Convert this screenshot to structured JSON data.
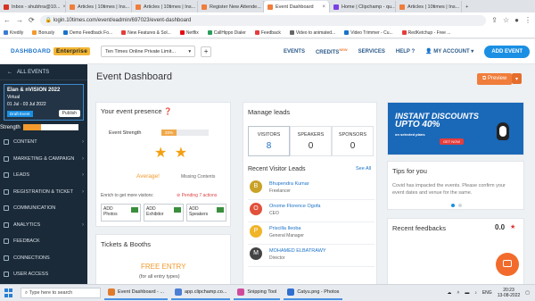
{
  "browser": {
    "tabs": [
      {
        "label": "Inbox - shubhra@10...",
        "color": "#d93025",
        "active": false
      },
      {
        "label": "Articles | 10times | Ins...",
        "color": "#f07d3b",
        "active": false
      },
      {
        "label": "Articles | 10times | Ins...",
        "color": "#f07d3b",
        "active": false
      },
      {
        "label": "Register New Attende...",
        "color": "#f07d3b",
        "active": false
      },
      {
        "label": "Event Dashboard",
        "color": "#f07d3b",
        "active": true
      },
      {
        "label": "Home | Clipchamp - qu...",
        "color": "#7b3fe4",
        "active": false
      },
      {
        "label": "Articles | 10times | Ins...",
        "color": "#f07d3b",
        "active": false
      }
    ],
    "url": "login.10times.com/event/eadmin/697023/event-dashboard",
    "bookmarks": [
      {
        "label": "Kredily",
        "color": "#3a7bd5"
      },
      {
        "label": "Bonusly",
        "color": "#f29a2e"
      },
      {
        "label": "Demo Feedback Fo...",
        "color": "#1a72c9"
      },
      {
        "label": "New Features & Sol...",
        "color": "#e53d3d"
      },
      {
        "label": "Netflix",
        "color": "#e50914"
      },
      {
        "label": "CallHippo Dialer",
        "color": "#2a9d5c"
      },
      {
        "label": "Feedback",
        "color": "#e53d3d"
      },
      {
        "label": "Video to animated...",
        "color": "#666666"
      },
      {
        "label": "Video Trimmer - Cu...",
        "color": "#1a72c9"
      },
      {
        "label": "RedKetchup - Free ...",
        "color": "#e53d3d"
      }
    ]
  },
  "app": {
    "logo": "DASHBOARD",
    "logo_badge": "Enterprise",
    "org_select": "Ten Times Online Private Limit...",
    "nav": {
      "events": "EVENTS",
      "credits": "CREDITS",
      "credits_badge": "NEW",
      "services": "SERVICES",
      "help": "HELP",
      "account": "MY ACCOUNT",
      "add_event": "ADD EVENT"
    }
  },
  "sidebar": {
    "all_events": "ALL EVENTS",
    "event_title": "Elan & nVISION 2022",
    "event_type": "Virtual",
    "event_dates": "01 Jul - 03 Jul 2022",
    "draft": "Draft Event",
    "publish": "Publish",
    "strength_label": "Strength",
    "strength_value": "33%",
    "strength_fraction": 0.33,
    "menu": [
      {
        "label": "CONTENT",
        "arrow": "›"
      },
      {
        "label": "MARKETING & CAMPAIGN",
        "arrow": "›"
      },
      {
        "label": "LEADS",
        "arrow": "›"
      },
      {
        "label": "REGISTRATION & TICKET",
        "arrow": "›"
      },
      {
        "label": "COMMUNICATION",
        "arrow": ""
      },
      {
        "label": "ANALYTICS",
        "arrow": "›"
      },
      {
        "label": "FEEDBACK",
        "arrow": ""
      },
      {
        "label": "CONNECTIONS",
        "arrow": ""
      },
      {
        "label": "USER ACCESS",
        "arrow": ""
      }
    ]
  },
  "main": {
    "title": "Event Dashboard",
    "preview": "Preview",
    "presence": {
      "title": "Your event presence",
      "strength_label": "Event Strength",
      "strength_value": "33%",
      "strength_fraction": 0.33,
      "stars": "★ ★",
      "rating": "Average!",
      "missing": "Missing Contents",
      "enrich": "Enrich to get more visitors:",
      "pending": "Pending 7 actions",
      "add": [
        {
          "line1": "ADD",
          "line2": "Photos"
        },
        {
          "line1": "ADD",
          "line2": "Exhibitor"
        },
        {
          "line1": "ADD",
          "line2": "Speakers"
        }
      ]
    },
    "tickets": {
      "title": "Tickets & Booths",
      "free": "FREE ENTRY",
      "free_sub": "(for all entry types)"
    },
    "leads": {
      "title": "Manage leads",
      "stats": [
        {
          "label": "VISITORS",
          "value": "8"
        },
        {
          "label": "SPEAKERS",
          "value": "0"
        },
        {
          "label": "SPONSORS",
          "value": "0"
        }
      ],
      "recent_title": "Recent Visitor Leads",
      "see_all": "See All",
      "visitors": [
        {
          "initial": "B",
          "color": "#c9a227",
          "name": "Bhupendra Kumar",
          "role": "Freelancer"
        },
        {
          "initial": "O",
          "color": "#e2523b",
          "name": "Onome Florence Ogofa",
          "role": "CEO"
        },
        {
          "initial": "P",
          "color": "#f0b429",
          "name": "Priscilla Ileoba",
          "role": "General Manager"
        },
        {
          "initial": "M",
          "color": "#444444",
          "name": "MOHAMED ELBATRAWY",
          "role": "Director"
        }
      ]
    },
    "promo": {
      "line1": "INSTANT DISCOUNTS",
      "line2": "UPTO 40%",
      "line3": "on selected plans",
      "button": "GET NOW"
    },
    "tips": {
      "title": "Tips for you",
      "text": "Covid has impacted the events. Please confirm your event dates and venue for the same."
    },
    "feedback": {
      "title": "Recent feedbacks",
      "value": "0.0",
      "star": "★"
    }
  },
  "taskbar": {
    "search": "Type here to search",
    "apps": [
      {
        "label": "Event Dashboard - ...",
        "color": "#e07b2c"
      },
      {
        "label": "app.clipchamp.co...",
        "color": "#4a7fd4"
      },
      {
        "label": "Snipping Tool",
        "color": "#d04a9c"
      },
      {
        "label": "Catyu.png - Photos",
        "color": "#2f6fd0"
      }
    ],
    "lang": "ENG",
    "time": "20:23",
    "date": "13-08-2022"
  }
}
